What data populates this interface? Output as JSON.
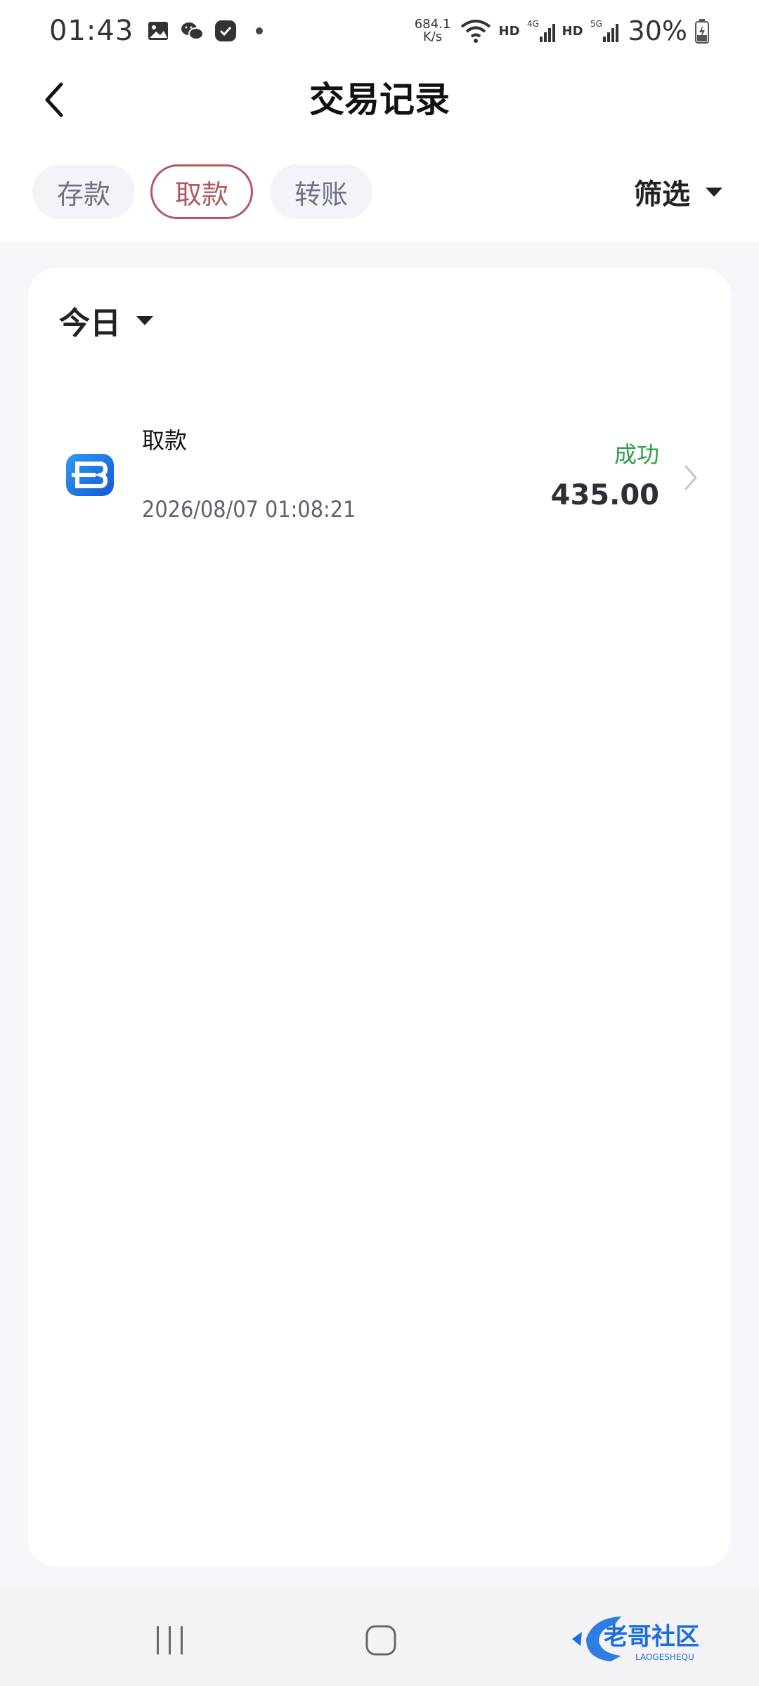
{
  "status_bar": {
    "time": "01:43",
    "net_speed_value": "684.1",
    "net_speed_unit": "K/s",
    "hd_label_1": "HD",
    "hd_label_2": "HD",
    "network_1": "4G",
    "network_2": "5G",
    "battery": "30%",
    "icons": [
      "gallery-icon",
      "wechat-icon",
      "app-badge-icon",
      "dot-icon",
      "wifi-icon",
      "signal-icon",
      "battery-icon"
    ]
  },
  "header": {
    "title": "交易记录",
    "back_icon": "chevron-left-icon"
  },
  "tabs": [
    {
      "label": "存款",
      "active": false
    },
    {
      "label": "取款",
      "active": true
    },
    {
      "label": "转账",
      "active": false
    }
  ],
  "filter": {
    "label": "筛选"
  },
  "date_filter": {
    "label": "今日"
  },
  "transactions": [
    {
      "title": "取款",
      "date": "2026/08/07 01:08:21",
      "status": "成功",
      "amount": "435.00"
    }
  ],
  "watermark": {
    "text": "老哥社区",
    "subtext": "LAOGESHEQU"
  },
  "colors": {
    "accent": "#b4585f",
    "success": "#2e9c4a",
    "background": "#f6f7fb",
    "card": "#ffffff",
    "tab_bg": "#f3f4f8",
    "logo_blue": "#1a73e8"
  }
}
